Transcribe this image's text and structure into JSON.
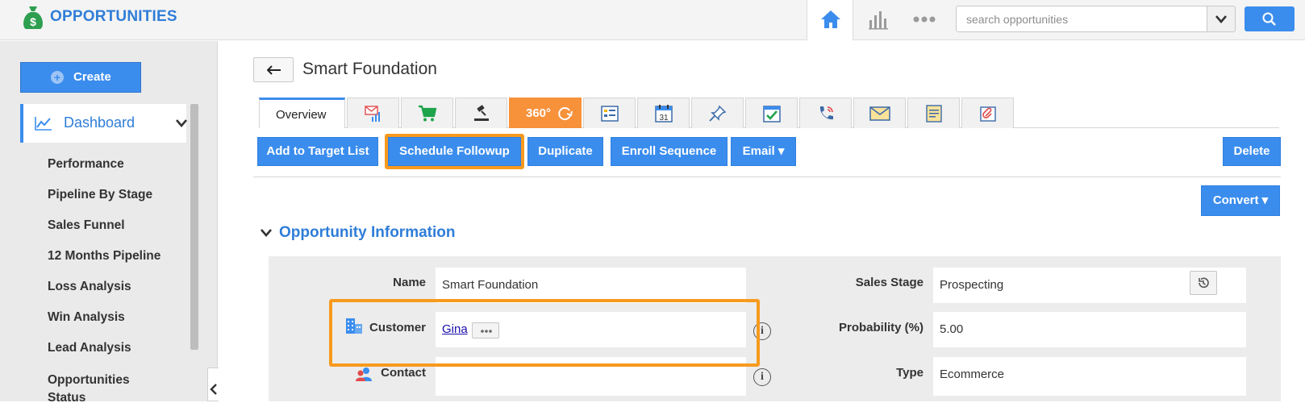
{
  "app": {
    "title": "OPPORTUNITIES"
  },
  "topnav": {
    "search_placeholder": "search opportunities",
    "icons": [
      "home-icon",
      "reports-icon",
      "more-icon",
      "chevron-down-icon",
      "search-icon"
    ]
  },
  "sidebar": {
    "create_label": "Create",
    "dashboard_label": "Dashboard",
    "items": [
      "Performance",
      "Pipeline By Stage",
      "Sales Funnel",
      "12 Months Pipeline",
      "Loss Analysis",
      "Win Analysis",
      "Lead Analysis",
      "Opportunities Status"
    ]
  },
  "record": {
    "title": "Smart Foundation"
  },
  "tabs": {
    "overview": "Overview",
    "icon_tabs": [
      "campaign-icon",
      "cart-icon",
      "gavel-icon",
      "360-icon",
      "list-icon",
      "calendar-icon",
      "pin-icon",
      "task-icon",
      "call-icon",
      "email-icon",
      "notes-icon",
      "attachment-icon"
    ],
    "calendar_day": "31",
    "label_360": "360°"
  },
  "actions": {
    "add_to_target": "Add to Target List",
    "schedule_followup": "Schedule Followup",
    "duplicate": "Duplicate",
    "enroll_sequence": "Enroll Sequence",
    "email": "Email ▾",
    "delete": "Delete",
    "convert": "Convert ▾"
  },
  "section": {
    "title": "Opportunity Information"
  },
  "form": {
    "name_label": "Name",
    "name_value": "Smart Foundation",
    "customer_label": "Customer",
    "customer_value": "Gina",
    "contact_label": "Contact",
    "contact_value": "",
    "sales_stage_label": "Sales Stage",
    "sales_stage_value": "Prospecting",
    "probability_label": "Probability (%)",
    "probability_value": "5.00",
    "type_label": "Type",
    "type_value": "Ecommerce"
  },
  "colors": {
    "accent": "#3b8ded",
    "highlight": "#f79a1e",
    "tab_360": "#f7913a"
  }
}
